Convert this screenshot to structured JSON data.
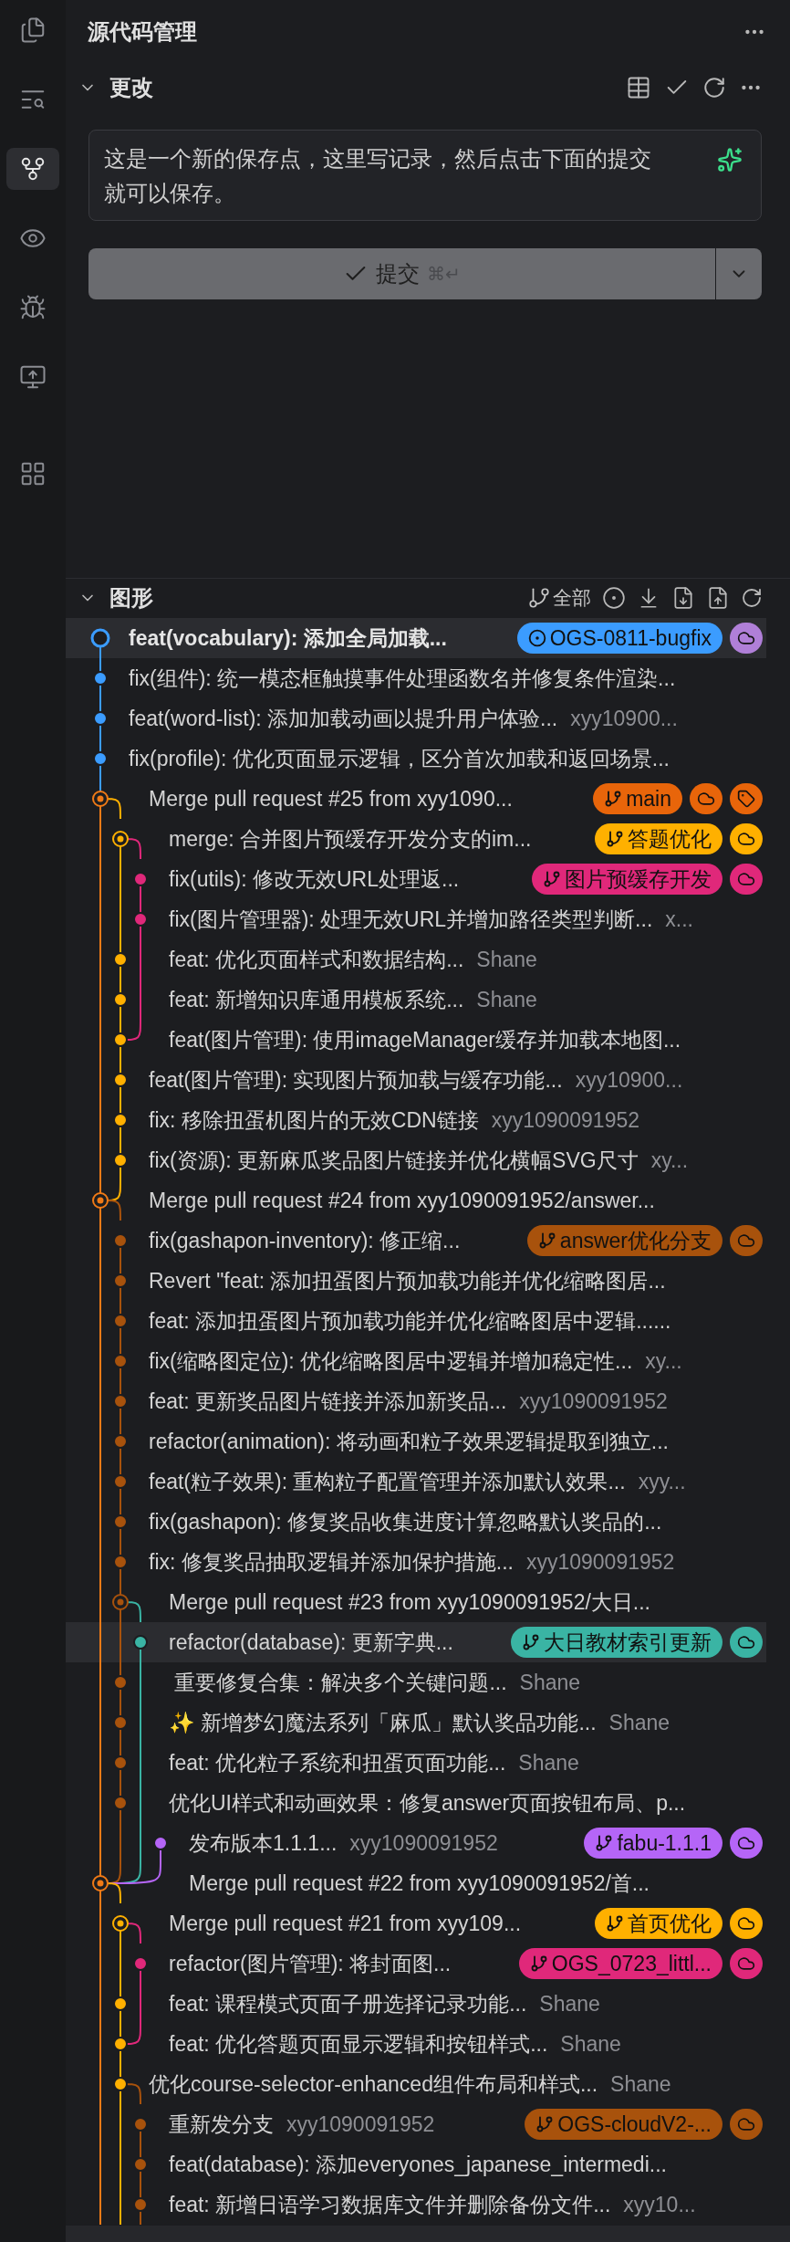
{
  "activity_bar": [
    {
      "kind": "files",
      "selected": false
    },
    {
      "kind": "search",
      "selected": false
    },
    {
      "kind": "source-control",
      "selected": true
    },
    {
      "kind": "eye",
      "selected": false
    },
    {
      "kind": "debug",
      "selected": false
    },
    {
      "kind": "remote",
      "selected": false
    },
    {
      "kind": "extensions",
      "selected": false
    }
  ],
  "title": "源代码管理",
  "changes": {
    "title": "更改",
    "expanded": true,
    "message": "这是一个新的保存点，这里写记录，然后点击下面的提交就可以保存。",
    "commit_label": "提交",
    "commit_shortcut": "⌘↵",
    "commit_disabled": true
  },
  "graph": {
    "title": "图形",
    "expanded": true,
    "filter_label": "全部",
    "rows": [
      {
        "kind": "head",
        "color": "#3b9cff",
        "message": "feat(vocabulary): 添加全局加载...",
        "highlighted": true,
        "refs": [
          {
            "kind": "current",
            "label": "OGS-0811-bugfix",
            "color": "#3b9cff"
          },
          {
            "kind": "remote",
            "color": "#b07fd8"
          }
        ]
      },
      {
        "kind": "commit",
        "color": "#3b9cff",
        "message": "fix(组件): 统一模态框触摸事件处理函数名并修复条件渲染...",
        "highlighted": false
      },
      {
        "kind": "commit",
        "color": "#3b9cff",
        "message": "feat(word-list): 添加加载动画以提升用户体验...",
        "author": "xyy10900...",
        "highlighted": false
      },
      {
        "kind": "commit",
        "color": "#3b9cff",
        "message": "fix(profile): 优化页面显示逻辑，区分首次加载和返回场景...",
        "highlighted": false
      },
      {
        "kind": "merge",
        "color": "#f07a16",
        "message": "Merge pull request #25 from xyy1090...",
        "highlighted": false,
        "refs": [
          {
            "kind": "branch",
            "label": "main",
            "color": "#e8650a"
          },
          {
            "kind": "remote",
            "color": "#e8650a"
          },
          {
            "kind": "tag",
            "color": "#e8650a"
          }
        ]
      },
      {
        "kind": "merge",
        "color": "#ffb000",
        "message": "merge: 合并图片预缓存开发分支的im...",
        "highlighted": false,
        "refs": [
          {
            "kind": "branch",
            "label": "答题优化",
            "color": "#ffb000"
          },
          {
            "kind": "remote",
            "color": "#ffb000"
          }
        ]
      },
      {
        "kind": "commit",
        "color": "#e0287a",
        "message": "fix(utils): 修改无效URL处理返...",
        "highlighted": false,
        "refs": [
          {
            "kind": "branch",
            "label": "图片预缓存开发",
            "color": "#e0287a"
          },
          {
            "kind": "remote",
            "color": "#e0287a"
          }
        ]
      },
      {
        "kind": "commit",
        "color": "#e0287a",
        "message": "fix(图片管理器): 处理无效URL并增加路径类型判断...",
        "author": "x...",
        "highlighted": false
      },
      {
        "kind": "commit",
        "color": "#ffb000",
        "message": "feat: 优化页面样式和数据结构...",
        "author": "Shane",
        "highlighted": false
      },
      {
        "kind": "commit",
        "color": "#ffb000",
        "message": "feat: 新增知识库通用模板系统...",
        "author": "Shane",
        "highlighted": false
      },
      {
        "kind": "commit",
        "color": "#ffb000",
        "message": "feat(图片管理): 使用imageManager缓存并加载本地图...",
        "highlighted": false
      },
      {
        "kind": "commit",
        "color": "#ffb000",
        "message": "feat(图片管理): 实现图片预加载与缓存功能...",
        "author": "xyy10900...",
        "highlighted": false
      },
      {
        "kind": "commit",
        "color": "#ffb000",
        "message": "fix: 移除扭蛋机图片的无效CDN链接",
        "author": "xyy1090091952",
        "highlighted": false
      },
      {
        "kind": "commit",
        "color": "#ffb000",
        "message": "fix(资源): 更新麻瓜奖品图片链接并优化横幅SVG尺寸",
        "author": "xy...",
        "highlighted": false
      },
      {
        "kind": "merge",
        "color": "#f07a16",
        "message": "Merge pull request #24 from xyy1090091952/answer...",
        "highlighted": false
      },
      {
        "kind": "commit",
        "color": "#a8520c",
        "message": "fix(gashapon-inventory): 修正缩...",
        "highlighted": false,
        "refs": [
          {
            "kind": "branch",
            "label": "answer优化分支",
            "color": "#a8520c"
          },
          {
            "kind": "remote",
            "color": "#a8520c"
          }
        ]
      },
      {
        "kind": "commit",
        "color": "#a8520c",
        "message": "Revert \"feat: 添加扭蛋图片预加载功能并优化缩略图居...",
        "highlighted": false
      },
      {
        "kind": "commit",
        "color": "#a8520c",
        "message": "feat: 添加扭蛋图片预加载功能并优化缩略图居中逻辑......",
        "highlighted": false
      },
      {
        "kind": "commit",
        "color": "#a8520c",
        "message": "fix(缩略图定位): 优化缩略图居中逻辑并增加稳定性...",
        "author": "xy...",
        "highlighted": false
      },
      {
        "kind": "commit",
        "color": "#a8520c",
        "message": "feat: 更新奖品图片链接并添加新奖品...",
        "author": "xyy1090091952",
        "highlighted": false
      },
      {
        "kind": "commit",
        "color": "#a8520c",
        "message": "refactor(animation): 将动画和粒子效果逻辑提取到独立...",
        "highlighted": false
      },
      {
        "kind": "commit",
        "color": "#a8520c",
        "message": "feat(粒子效果): 重构粒子配置管理并添加默认效果...",
        "author": "xyy...",
        "highlighted": false
      },
      {
        "kind": "commit",
        "color": "#a8520c",
        "message": "fix(gashapon): 修复奖品收集进度计算忽略默认奖品的...",
        "highlighted": false
      },
      {
        "kind": "commit",
        "color": "#a8520c",
        "message": "fix: 修复奖品抽取逻辑并添加保护措施...",
        "author": "xyy1090091952",
        "highlighted": false
      },
      {
        "kind": "merge",
        "color": "#a8520c",
        "message": "Merge pull request #23 from xyy1090091952/大日...",
        "highlighted": false
      },
      {
        "kind": "commit",
        "color": "#3ab4a4",
        "message": "refactor(database): 更新字典...",
        "highlighted": true,
        "refs": [
          {
            "kind": "branch",
            "label": "大日教材索引更新",
            "color": "#3ab4a4"
          },
          {
            "kind": "remote",
            "color": "#3ab4a4"
          }
        ]
      },
      {
        "kind": "commit",
        "color": "#a8520c",
        "message": " 重要修复合集：解决多个关键问题...",
        "author": "Shane",
        "highlighted": false
      },
      {
        "kind": "commit",
        "color": "#a8520c",
        "message": "✨ 新增梦幻魔法系列「麻瓜」默认奖品功能...",
        "author": "Shane",
        "highlighted": false
      },
      {
        "kind": "commit",
        "color": "#a8520c",
        "message": "feat: 优化粒子系统和扭蛋页面功能...",
        "author": "Shane",
        "highlighted": false
      },
      {
        "kind": "commit",
        "color": "#a8520c",
        "message": "优化UI样式和动画效果：修复answer页面按钮布局、p...",
        "highlighted": false
      },
      {
        "kind": "commit",
        "color": "#b565f7",
        "message": "发布版本1.1.1...",
        "author": "xyy1090091952",
        "highlighted": false,
        "refs": [
          {
            "kind": "branch",
            "label": "fabu-1.1.1",
            "color": "#b565f7"
          },
          {
            "kind": "remote",
            "color": "#b565f7"
          }
        ]
      },
      {
        "kind": "merge",
        "color": "#f07a16",
        "message": "Merge pull request #22 from xyy1090091952/首...",
        "highlighted": false
      },
      {
        "kind": "merge",
        "color": "#ffb000",
        "message": "Merge pull request #21 from xyy109...",
        "highlighted": false,
        "refs": [
          {
            "kind": "branch",
            "label": "首页优化",
            "color": "#ffb000"
          },
          {
            "kind": "remote",
            "color": "#ffb000"
          }
        ]
      },
      {
        "kind": "commit",
        "color": "#e0287a",
        "message": "refactor(图片管理): 将封面图...",
        "highlighted": false,
        "refs": [
          {
            "kind": "branch",
            "label": "OGS_0723_littl...",
            "color": "#e0287a"
          },
          {
            "kind": "remote",
            "color": "#e0287a"
          }
        ]
      },
      {
        "kind": "commit",
        "color": "#ffb000",
        "message": "feat: 课程模式页面子册选择记录功能...",
        "author": "Shane",
        "highlighted": false
      },
      {
        "kind": "commit",
        "color": "#ffb000",
        "message": "feat: 优化答题页面显示逻辑和按钮样式...",
        "author": "Shane",
        "highlighted": false
      },
      {
        "kind": "commit",
        "color": "#ffb000",
        "message": "优化course-selector-enhanced组件布局和样式...",
        "author": "Shane",
        "highlighted": false
      },
      {
        "kind": "commit",
        "color": "#a8520c",
        "message": "重新发分支",
        "author": "xyy1090091952",
        "highlighted": false,
        "refs": [
          {
            "kind": "branch",
            "label": "OGS-cloudV2-...",
            "color": "#a8520c"
          },
          {
            "kind": "remote",
            "color": "#a8520c"
          }
        ]
      },
      {
        "kind": "commit",
        "color": "#a8520c",
        "message": "feat(database): 添加everyones_japanese_intermedi...",
        "highlighted": false
      },
      {
        "kind": "commit",
        "color": "#a8520c",
        "message": "feat: 新增日语学习数据库文件并删除备份文件...",
        "author": "xyy10...",
        "highlighted": false
      }
    ]
  }
}
